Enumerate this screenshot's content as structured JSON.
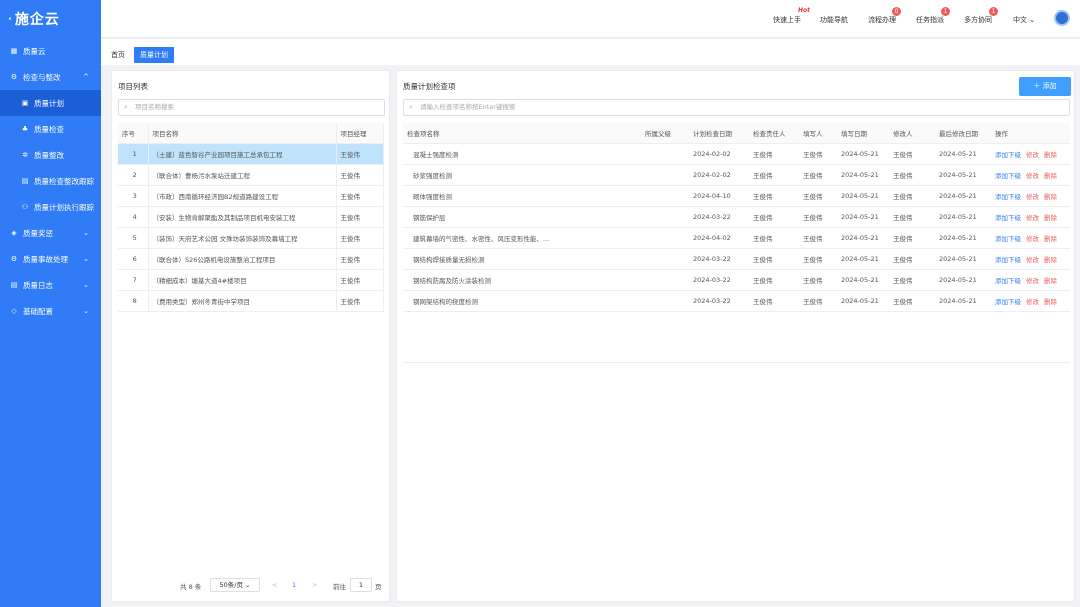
{
  "sidebar": {
    "logo": "施企云",
    "items": [
      {
        "label": "质量云",
        "icon": "grid-icon",
        "glyph": "▦",
        "chev": ""
      },
      {
        "label": "检查与整改",
        "icon": "gear-icon",
        "glyph": "⚙",
        "chev": "^"
      },
      {
        "label": "质量计划",
        "icon": "clipboard-icon",
        "glyph": "▣",
        "chev": "",
        "sub": true,
        "active": true
      },
      {
        "label": "质量检查",
        "icon": "org-icon",
        "glyph": "♣",
        "chev": "",
        "sub": true
      },
      {
        "label": "质量整改",
        "icon": "gear-icon",
        "glyph": "✲",
        "chev": "",
        "sub": true
      },
      {
        "label": "质量检查整改跟踪",
        "icon": "table-icon",
        "glyph": "▤",
        "chev": "",
        "sub": true
      },
      {
        "label": "质量计划执行跟踪",
        "icon": "people-icon",
        "glyph": "⚇",
        "chev": "",
        "sub": true
      },
      {
        "label": "质量奖惩",
        "icon": "box-icon",
        "glyph": "◈",
        "chev": "⌄"
      },
      {
        "label": "质量事故处理",
        "icon": "gear-icon",
        "glyph": "⚙",
        "chev": "⌄"
      },
      {
        "label": "质量日志",
        "icon": "table-icon",
        "glyph": "▤",
        "chev": "⌄"
      },
      {
        "label": "基础配置",
        "icon": "layers-icon",
        "glyph": "◇",
        "chev": "⌄"
      }
    ]
  },
  "topbar": {
    "quick_start": "快速上手",
    "hot_badge": "Hot",
    "function_nav": "功能导航",
    "process": "流程办理",
    "process_badge": "0",
    "task": "任务指派",
    "task_badge": "1",
    "collab": "多方协同",
    "collab_badge": "1",
    "language": "中文"
  },
  "tabs": [
    "首页",
    "质量计划"
  ],
  "left_panel": {
    "title": "项目列表",
    "search_placeholder": "项目名称搜索",
    "columns": [
      "序号",
      "项目名称",
      "项目经理"
    ],
    "rows": [
      [
        "1",
        "（土建）蓝色智谷产业园项目施工总承包工程",
        "王俊伟"
      ],
      [
        "2",
        "（联合体）曹杨污水泵站迁建工程",
        "王俊伟"
      ],
      [
        "3",
        "（市政）西南循环经济园B2规道路建设工程",
        "王俊伟"
      ],
      [
        "4",
        "（安装）生物肯解聚酯及其制品项目机电安装工程",
        "王俊伟"
      ],
      [
        "5",
        "（装饰）天府艺术公园 文殊坊装饰装饰及幕墙工程",
        "王俊伟"
      ],
      [
        "6",
        "（联合体）S26公路机电设施整治工程项目",
        "王俊伟"
      ],
      [
        "7",
        "（精细成本）塘基大道4#楼项目",
        "王俊伟"
      ],
      [
        "8",
        "（费用类型）郑州冬青街中学项目",
        "王俊伟"
      ]
    ],
    "pager": {
      "total": "共 8 条",
      "page_size": "50条/页",
      "prev": "<",
      "current": "1",
      "next": ">",
      "goto": "前往",
      "goto_value": "1",
      "page_unit": "页"
    }
  },
  "right_panel": {
    "title": "质量计划检查项",
    "add_button": "添加",
    "search_placeholder": "请输入检查项名称按Enter键搜索",
    "columns": [
      "检查项名称",
      "所属父级",
      "计划检查日期",
      "检查责任人",
      "填写人",
      "填写日期",
      "修改人",
      "最后修改日期",
      "操作"
    ],
    "rows": [
      [
        "混凝土强度检测",
        "",
        "2024-02-02",
        "王俊伟",
        "王俊伟",
        "2024-05-21",
        "王俊伟",
        "2024-05-21"
      ],
      [
        "砂浆强度检测",
        "",
        "2024-02-02",
        "王俊伟",
        "王俊伟",
        "2024-05-21",
        "王俊伟",
        "2024-05-21"
      ],
      [
        "砌体强度检测",
        "",
        "2024-04-10",
        "王俊伟",
        "王俊伟",
        "2024-05-21",
        "王俊伟",
        "2024-05-21"
      ],
      [
        "钢筋保护层",
        "",
        "2024-03-22",
        "王俊伟",
        "王俊伟",
        "2024-05-21",
        "王俊伟",
        "2024-05-21"
      ],
      [
        "建筑幕墙的气密性、水密性、风压变形性能、...",
        "",
        "2024-04-02",
        "王俊伟",
        "王俊伟",
        "2024-05-21",
        "王俊伟",
        "2024-05-21"
      ],
      [
        "钢结构焊接质量无损检测",
        "",
        "2024-03-22",
        "王俊伟",
        "王俊伟",
        "2024-05-21",
        "王俊伟",
        "2024-05-21"
      ],
      [
        "钢结构防腐及防火涂装检测",
        "",
        "2024-03-22",
        "王俊伟",
        "王俊伟",
        "2024-05-21",
        "王俊伟",
        "2024-05-21"
      ],
      [
        "钢网架结构的挠度检测",
        "",
        "2024-03-22",
        "王俊伟",
        "王俊伟",
        "2024-05-21",
        "王俊伟",
        "2024-05-21"
      ]
    ],
    "actions": {
      "add_sub": "添加下级",
      "edit": "修改",
      "delete": "删除"
    }
  },
  "colors": {
    "sidebar": "#2f7cf6",
    "accent": "#409eff",
    "danger": "#f25b5b",
    "selected_row": "#bfe3fb"
  }
}
